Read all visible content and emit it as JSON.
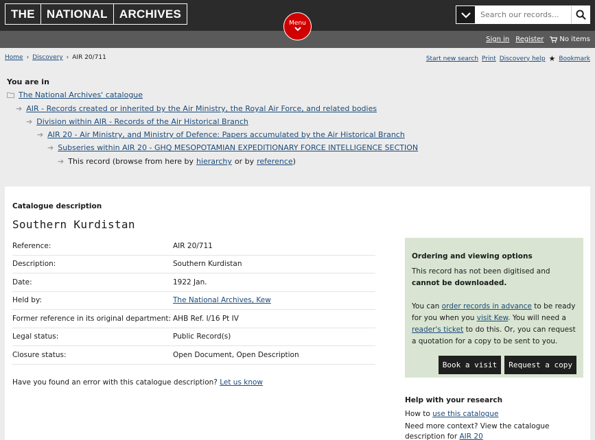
{
  "header": {
    "logo": [
      "THE",
      "NATIONAL",
      "ARCHIVES"
    ],
    "search_placeholder": "Search our records...",
    "menu_label": "Menu"
  },
  "account": {
    "sign_in": "Sign in",
    "register": "Register",
    "cart": "No items"
  },
  "breadcrumb": {
    "items": [
      "Home",
      "Discovery",
      "AIR 20/711"
    ]
  },
  "utility_links": {
    "start_new_search": "Start new search",
    "print": "Print",
    "discovery_help": "Discovery help",
    "bookmark": "Bookmark"
  },
  "you_are_in": {
    "title": "You are in",
    "levels": [
      "The National Archives' catalogue",
      "AIR - Records created or inherited by the Air Ministry, the Royal Air Force, and related bodies",
      "Division within AIR - Records of the Air Historical Branch",
      "AIR 20 - Air Ministry, and Ministry of Defence: Papers accumulated by the Air Historical Branch",
      "Subseries within AIR 20 - GHQ MESOPOTAMIAN EXPEDITIONARY FORCE INTELLIGENCE SECTION"
    ],
    "this_record_prefix": "This record (browse from here by",
    "hierarchy": "hierarchy",
    "or_by": "or by",
    "reference": "reference",
    "suffix": ")"
  },
  "record": {
    "section_label": "Catalogue description",
    "title": "Southern Kurdistan",
    "details": [
      {
        "key": "Reference:",
        "value": "AIR 20/711"
      },
      {
        "key": "Description:",
        "value": "Southern Kurdistan"
      },
      {
        "key": "Date:",
        "value": "1922 Jan."
      },
      {
        "key": "Held by:",
        "value": "The National Archives, Kew"
      },
      {
        "key": "Former reference in its original department:",
        "value": "AHB Ref. I/16 Pt IV"
      },
      {
        "key": "Legal status:",
        "value": "Public Record(s)"
      },
      {
        "key": "Closure status:",
        "value": "Open Document, Open Description"
      }
    ],
    "error_question": "Have you found an error with this catalogue description?",
    "let_us_know": "Let us know"
  },
  "ordering": {
    "title": "Ordering and viewing options",
    "p1_a": "This record has not been digitised and",
    "p1_b": "cannot be downloaded.",
    "p2_a": "You can",
    "p2_link1": "order records in advance",
    "p2_b": "to be ready for you when you",
    "p2_link2": "visit Kew",
    "p2_c": ". You will need a",
    "p2_link3": "reader's ticket",
    "p2_d": "to do this. Or, you can request a quotation for a copy to be sent to you.",
    "book_visit": "Book a visit",
    "request_copy": "Request a copy"
  },
  "help": {
    "title": "Help with your research",
    "how_to": "How to",
    "use_catalogue": "use this catalogue",
    "need_more": "Need more context? View the catalogue description for",
    "air20": "AIR 20"
  }
}
